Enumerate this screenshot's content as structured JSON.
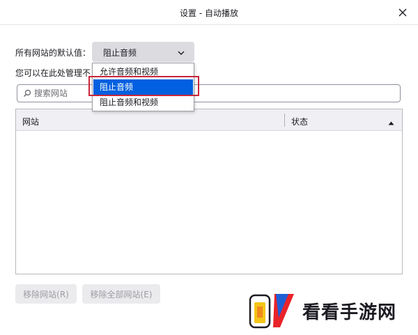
{
  "dialog": {
    "title": "设置 - 自动播放",
    "close_icon": "close-icon"
  },
  "default_setting": {
    "label": "所有网站的默认值：",
    "selected": "阻止音频",
    "options": [
      "允许音频和视频",
      "阻止音频",
      "阻止音频和视频"
    ]
  },
  "description": "您可以在此处管理不遵循默认设置的网站",
  "search": {
    "placeholder": "搜索网站",
    "value": ""
  },
  "table": {
    "columns": [
      "网站",
      "状态"
    ],
    "sort": "ascending",
    "rows": []
  },
  "buttons": {
    "remove_site": "移除网站(R)",
    "remove_all": "移除全部网站(E)"
  },
  "watermark": {
    "text": "看看手游网"
  },
  "colors": {
    "accent": "#0060df",
    "highlight_border": "#c8253a",
    "select_bg": "#dcdce0"
  }
}
